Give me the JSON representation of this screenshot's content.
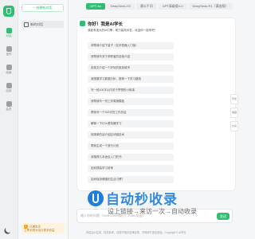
{
  "sidebar": {
    "items": [
      {
        "label": "对话",
        "icon": "chat-icon"
      },
      {
        "label": "创作",
        "icon": "pen-icon"
      },
      {
        "label": "绘画",
        "icon": "palette-icon"
      },
      {
        "label": "应用",
        "icon": "apps-icon"
      },
      {
        "label": "会员",
        "icon": "crown-icon"
      }
    ]
  },
  "panel": {
    "new_chat_label": "+ 创建新对话",
    "conversations": [
      "新的对话"
    ],
    "promo": {
      "title": "开通会员",
      "subtitle": "立享无限对话与更多权益"
    }
  },
  "tabs": [
    {
      "label": "GPT-4o",
      "active": true
    },
    {
      "label": "DeepSeek-V3",
      "active": false
    },
    {
      "label": "通义千问",
      "active": false
    },
    {
      "label": "GPT高级版4.0",
      "active": false
    },
    {
      "label": "DeepSeek-R1（满血版）",
      "active": false
    }
  ],
  "chat": {
    "greeting_title": "你好！我是AI学长",
    "greeting_subtitle": "我能有强大的AI引擎，助力高效问答，欢迎你一起来吧！",
    "suggestions": [
      "请帮我介绍下量子（友好易懂入门版）",
      "请帮我写关于求职者的自我介绍",
      "用英文介绍一个好玩的旅游城市",
      "我想要学习数据分析，推荐一下学习路线",
      "写一段100字以内关于梦想的小故事",
      "请帮我写一份工作周报模板",
      "帮我写一个300字的工作总结",
      "解释一下什么是机器学习",
      "用简单的话介绍区块链技术",
      "帮我生成一个旅行计划",
      "请推荐几本适合入门的书",
      "如何提高学习效率",
      "如何保持健康的生活习惯？"
    ],
    "side_buttons": [
      {
        "label": "历史",
        "icon": "history-icon"
      },
      {
        "label": "收藏",
        "icon": "star-icon"
      },
      {
        "label": "分享",
        "icon": "share-icon"
      }
    ]
  },
  "watermark": {
    "text": "自动秒收录",
    "subtitle": "设上链接→来访一次→自动收录"
  },
  "input": {
    "placeholder": "输入你的问题（Shift+Enter换行，Enter发送）",
    "send_label": "发送"
  },
  "disclaimer": "内容由AI生成，仅供参考，请遵守相关法律法规，不得用于违法用途。Copyright © AI学长"
}
